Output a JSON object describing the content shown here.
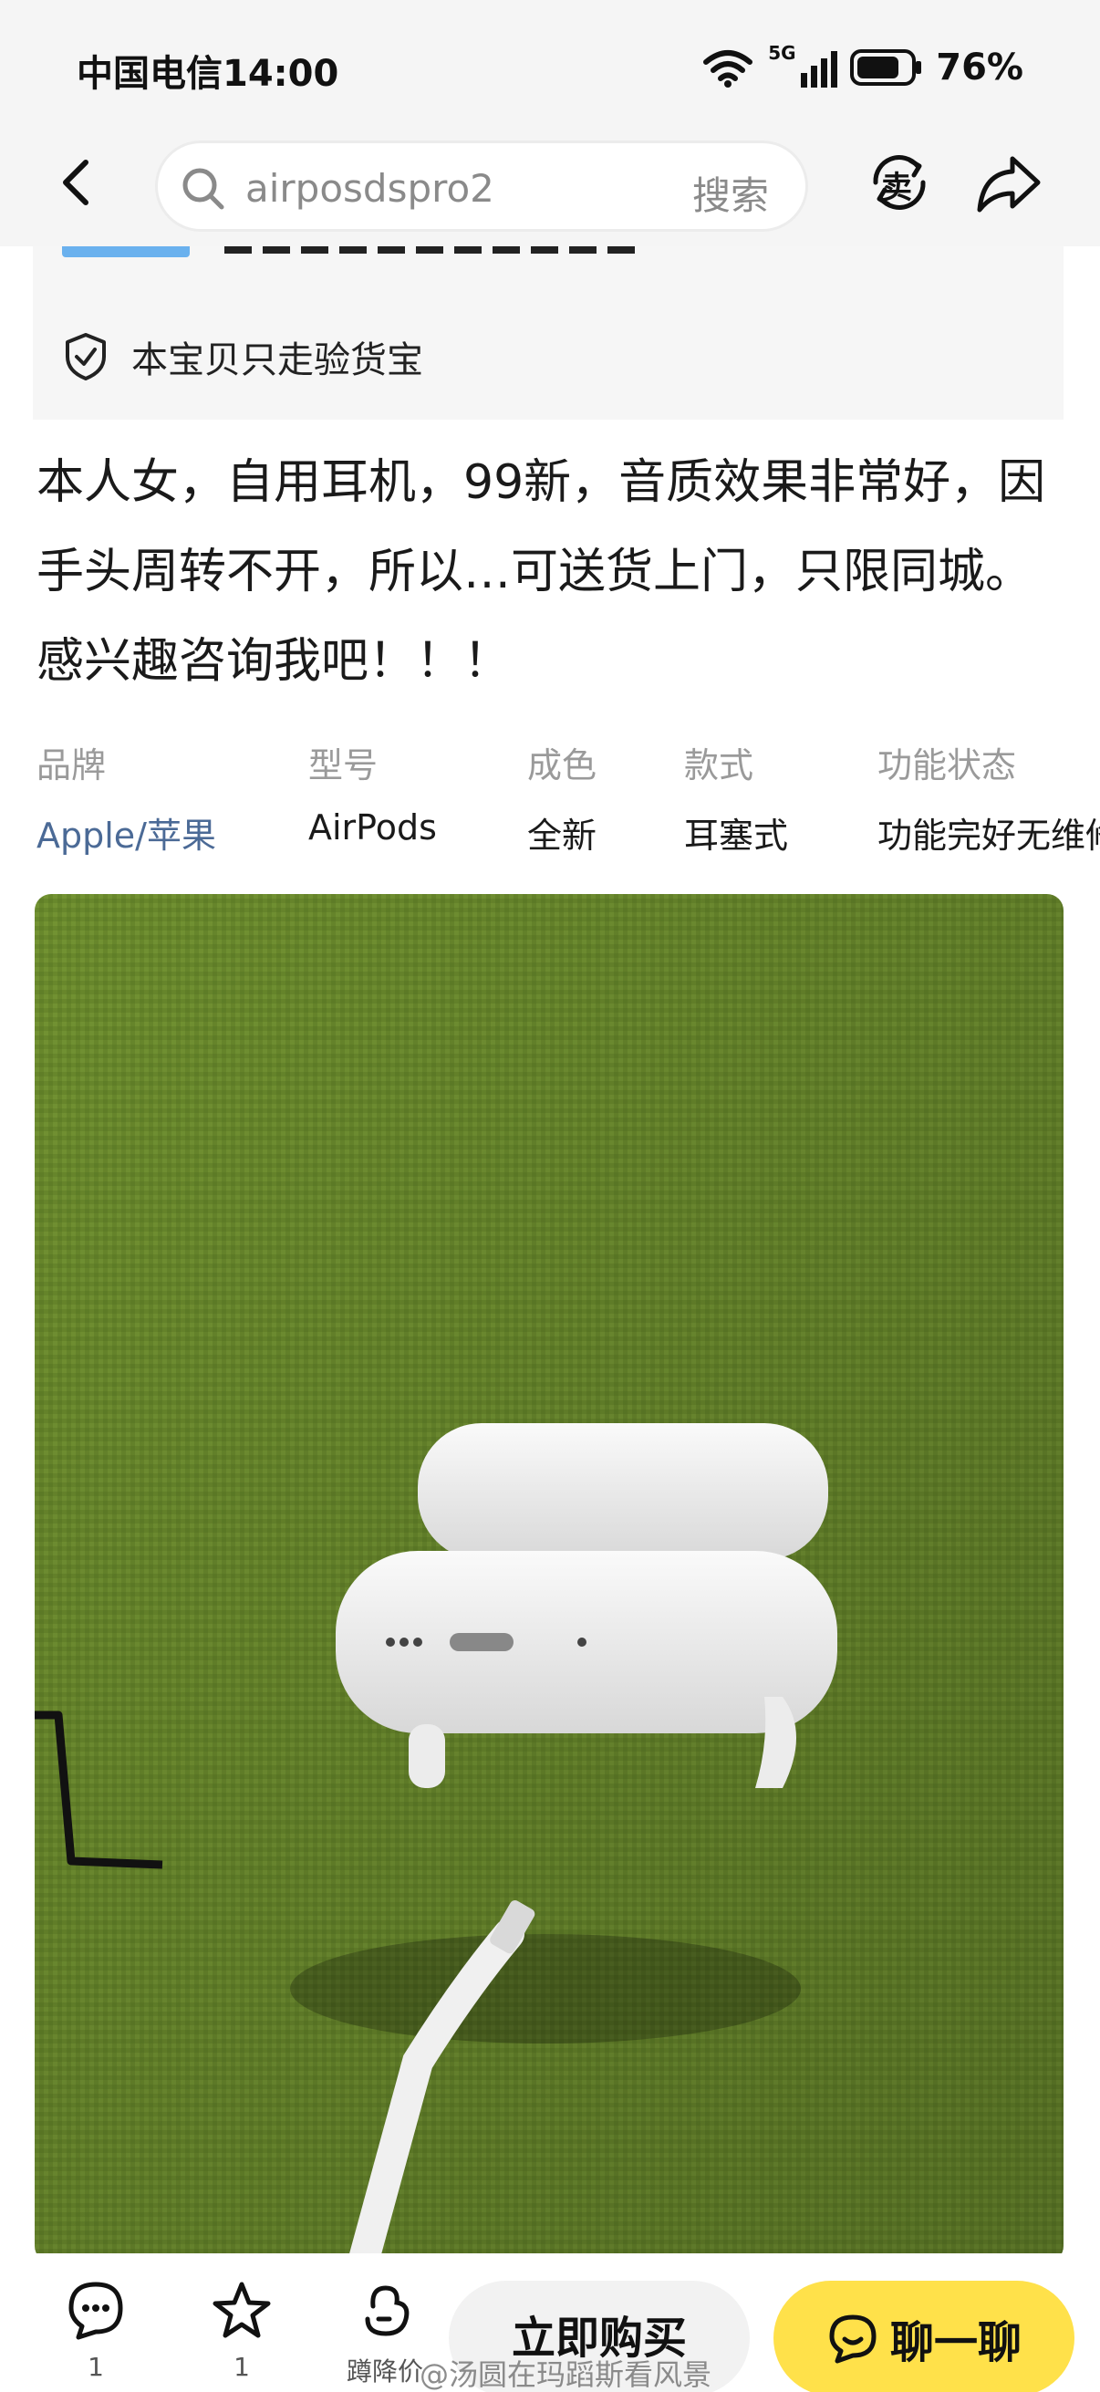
{
  "status_bar": {
    "carrier_time": "中国电信14:00",
    "signal_label": "5G",
    "battery": "76%"
  },
  "nav": {
    "search_value": "airposdspro2",
    "search_button": "搜索",
    "sell_icon": "卖"
  },
  "verify": {
    "text": "本宝贝只走验货宝"
  },
  "description": {
    "lines": [
      "本人女，自用耳机，99新，音质效果非常好，因",
      "手头周转不开，所以…可送货上门，只限同城。",
      "感兴趣咨询我吧！！！"
    ]
  },
  "attributes": [
    {
      "key": "品牌",
      "value": "Apple/苹果"
    },
    {
      "key": "型号",
      "value": "AirPods"
    },
    {
      "key": "成色",
      "value": "全新"
    },
    {
      "key": "款式",
      "value": "耳塞式"
    },
    {
      "key": "功能状态",
      "value": "功能完好无维修"
    }
  ],
  "bottom_bar": {
    "comment_count": "1",
    "favorite_count": "1",
    "price_cut_label": "蹲降价",
    "buy_label": "立即购买",
    "chat_label": "聊一聊"
  },
  "watermark": "@汤圆在玛蹈斯看风景",
  "colors": {
    "accent_yellow": "#ffe14a",
    "brand_link": "#4b6a96",
    "muted": "#9a9a9a"
  }
}
